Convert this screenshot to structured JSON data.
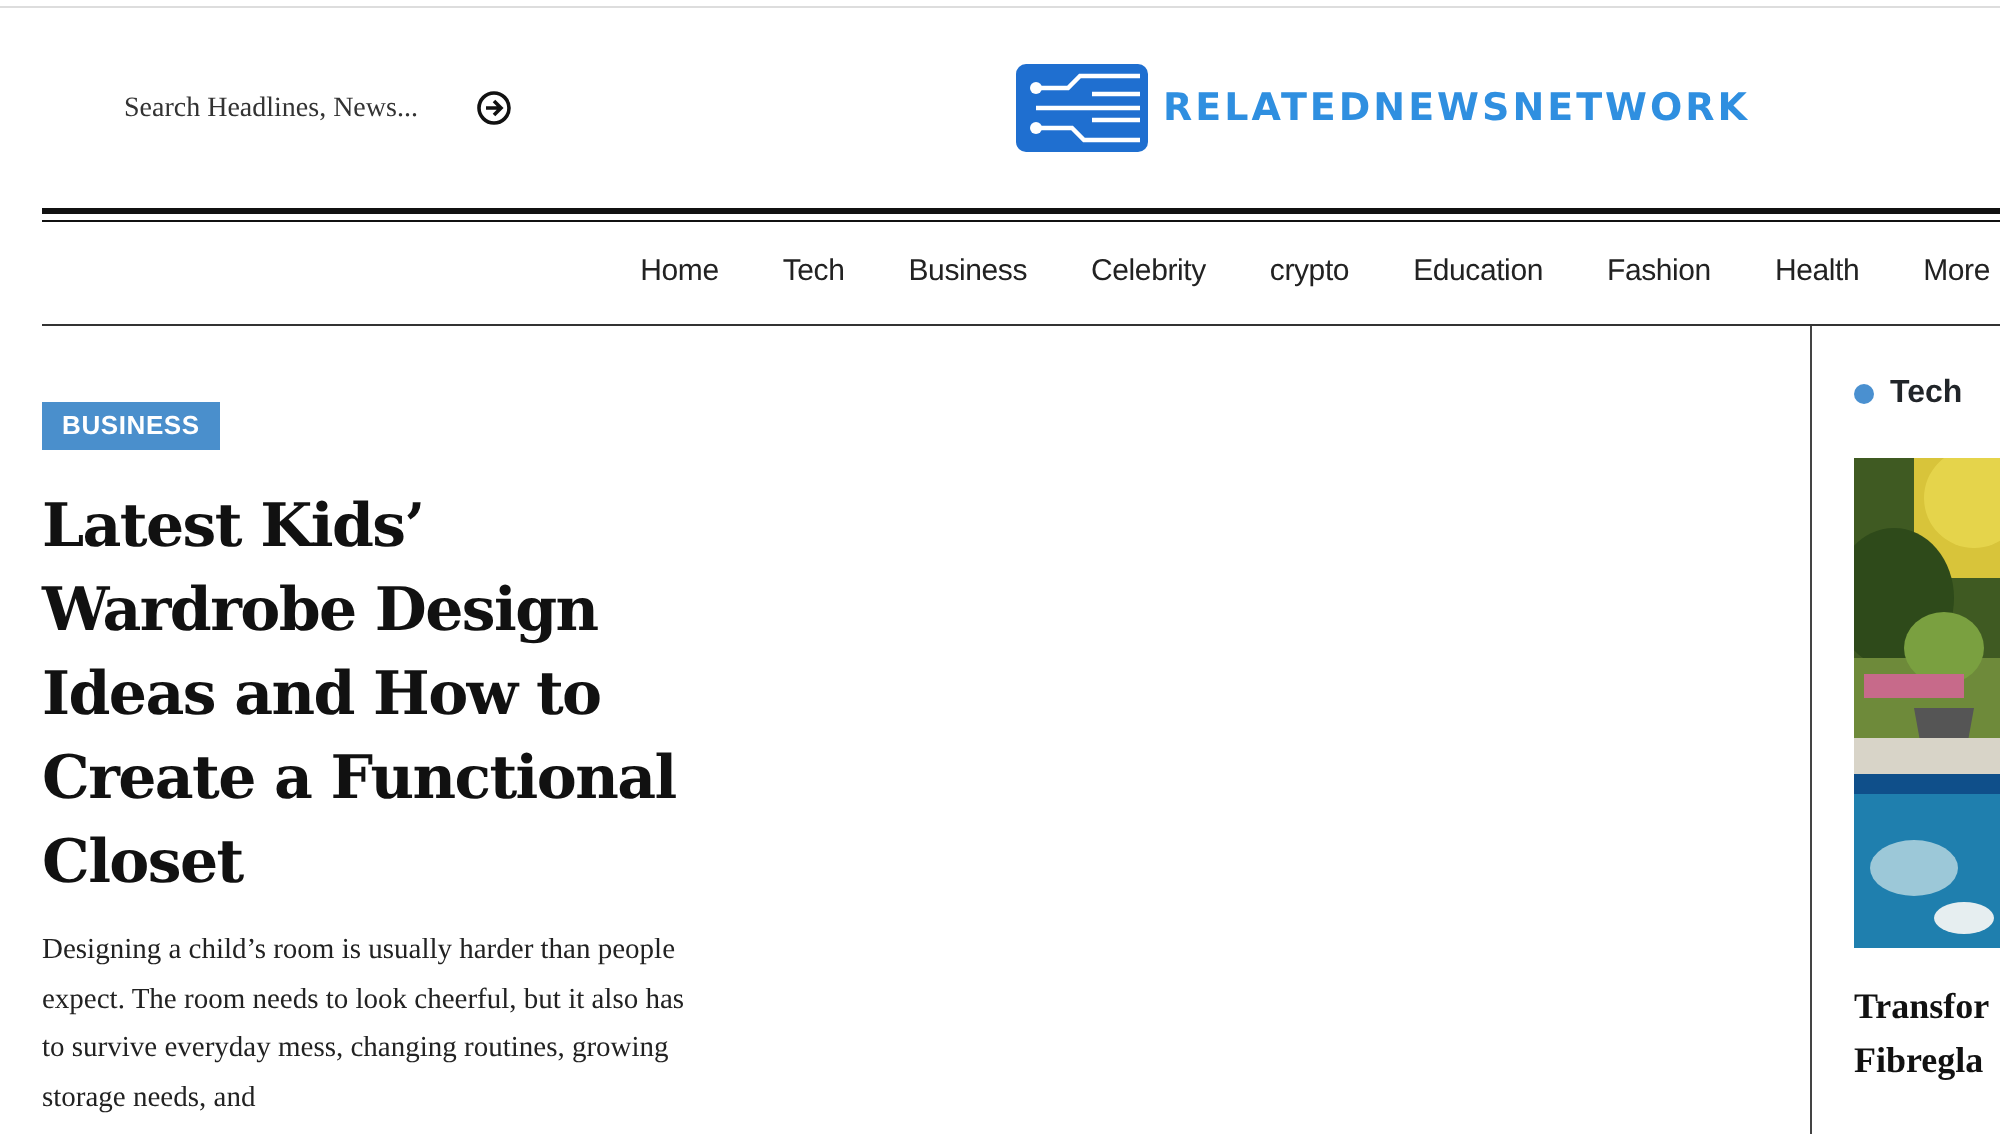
{
  "header": {
    "search": {
      "placeholder": "Search Headlines, News..."
    },
    "logo": {
      "text": "RELATEDNEWSNETWORK"
    }
  },
  "nav": {
    "items": [
      {
        "label": "Home"
      },
      {
        "label": "Tech"
      },
      {
        "label": "Business"
      },
      {
        "label": "Celebrity"
      },
      {
        "label": "crypto"
      },
      {
        "label": "Education"
      },
      {
        "label": "Fashion"
      },
      {
        "label": "Health"
      },
      {
        "label": "More"
      }
    ]
  },
  "article": {
    "category": "BUSINESS",
    "title": "Latest Kids’ Wardrobe Design Ideas and How to Create a Functional Closet",
    "excerpt": "Designing a child’s room is usually harder than people expect. The room needs to look cheerful, but it also has to survive everyday mess, changing routines, growing storage needs, and"
  },
  "sidebar": {
    "heading": "Tech",
    "color": "#4a90d0",
    "post": {
      "title_lines": [
        "Transfor",
        "Fibregla"
      ]
    }
  }
}
